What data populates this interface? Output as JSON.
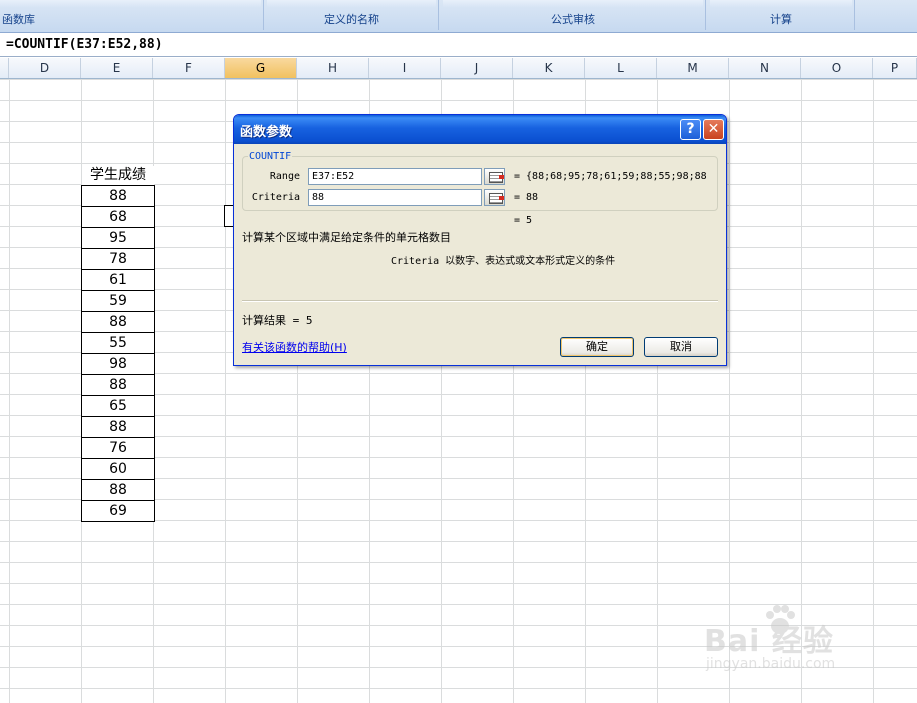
{
  "ribbon": {
    "groups": [
      "函数库",
      "定义的名称",
      "公式审核",
      "计算"
    ]
  },
  "formula_bar": {
    "text": "=COUNTIF(E37:E52,88)"
  },
  "columns": {
    "headers": [
      "D",
      "E",
      "F",
      "G",
      "H",
      "I",
      "J",
      "K",
      "L",
      "M",
      "N",
      "O",
      "P"
    ],
    "selected": "G"
  },
  "sheet": {
    "score_header": "学生成绩",
    "scores": [
      "88",
      "68",
      "95",
      "78",
      "61",
      "59",
      "88",
      "55",
      "98",
      "88",
      "65",
      "88",
      "76",
      "60",
      "88",
      "69"
    ]
  },
  "dialog": {
    "title": "函数参数",
    "help_glyph": "?",
    "close_glyph": "✕",
    "function_name": "COUNTIF",
    "args": [
      {
        "label": "Range",
        "value": "E37:E52",
        "eq_value": "= {88;68;95;78;61;59;88;55;98;88"
      },
      {
        "label": "Criteria",
        "value": "88",
        "eq_value": "= 88"
      }
    ],
    "inline_result": "= 5",
    "function_description": "计算某个区域中满足给定条件的单元格数目",
    "argument_description": "Criteria  以数字、表达式或文本形式定义的条件",
    "calc_result": "计算结果 = 5",
    "help_link": "有关该函数的帮助(H)",
    "ok_label": "确定",
    "cancel_label": "取消"
  },
  "watermark": {
    "main": "Bai  经验",
    "sub": "jingyan.baidu.com"
  }
}
